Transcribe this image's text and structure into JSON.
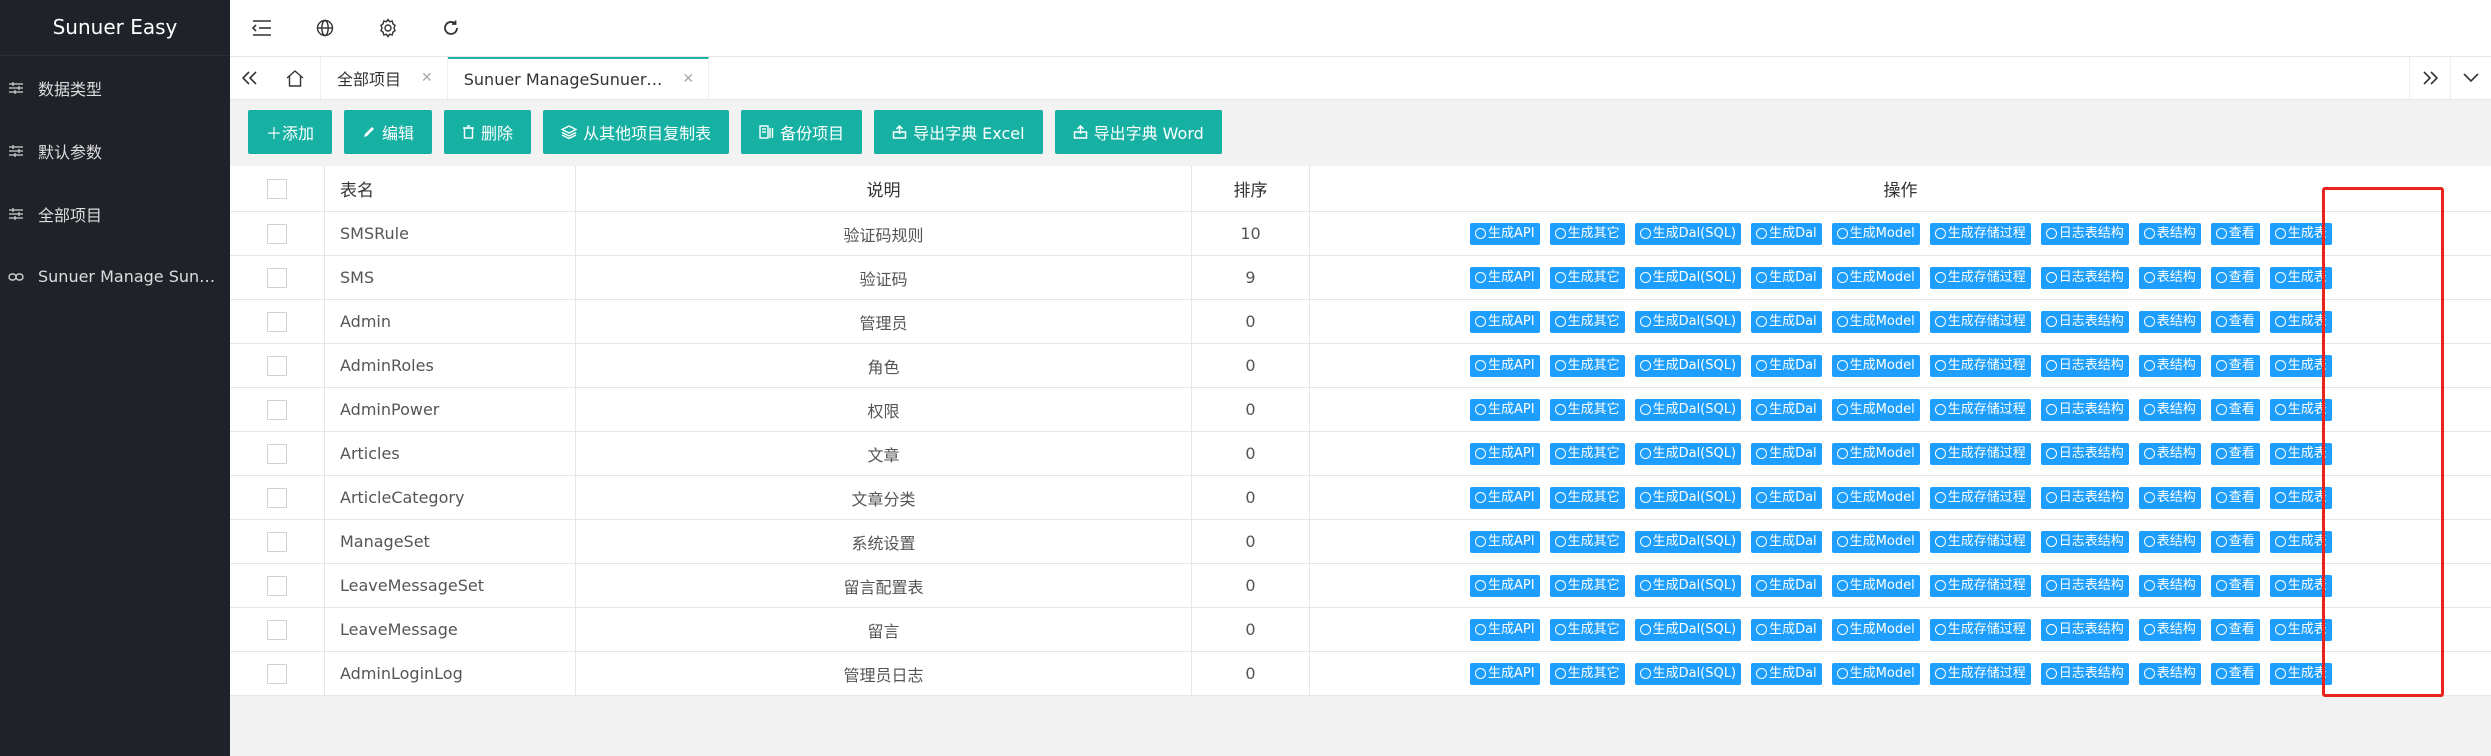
{
  "app": {
    "title": "Sunuer Easy"
  },
  "sidebar": {
    "items": [
      {
        "label": "数据类型",
        "icon": "sliders-icon"
      },
      {
        "label": "默认参数",
        "icon": "sliders-icon"
      },
      {
        "label": "全部项目",
        "icon": "sliders-icon"
      },
      {
        "label": "Sunuer Manage Sun…",
        "icon": "link-icon"
      }
    ]
  },
  "topbar": {
    "icons": [
      "menu-toggle-icon",
      "globe-icon",
      "gear-icon",
      "refresh-icon"
    ]
  },
  "tabs": [
    {
      "label": "全部项目",
      "active": false
    },
    {
      "label": "Sunuer ManageSunuer…",
      "active": true
    }
  ],
  "toolbar": {
    "add": "添加",
    "edit": "编辑",
    "delete": "删除",
    "copy": "从其他项目复制表",
    "backup": "备份项目",
    "export_excel": "导出字典 Excel",
    "export_word": "导出字典 Word"
  },
  "table": {
    "headers": {
      "name": "表名",
      "desc": "说明",
      "sort": "排序",
      "ops": "操作"
    },
    "actions": [
      "生成API",
      "生成其它",
      "生成Dal(SQL)",
      "生成Dal",
      "生成Model",
      "生成存储过程",
      "日志表结构",
      "表结构",
      "查看",
      "生成表"
    ],
    "rows": [
      {
        "name": "SMSRule",
        "desc": "验证码规则",
        "sort": "10"
      },
      {
        "name": "SMS",
        "desc": "验证码",
        "sort": "9"
      },
      {
        "name": "Admin",
        "desc": "管理员",
        "sort": "0"
      },
      {
        "name": "AdminRoles",
        "desc": "角色",
        "sort": "0"
      },
      {
        "name": "AdminPower",
        "desc": "权限",
        "sort": "0"
      },
      {
        "name": "Articles",
        "desc": "文章",
        "sort": "0"
      },
      {
        "name": "ArticleCategory",
        "desc": "文章分类",
        "sort": "0"
      },
      {
        "name": "ManageSet",
        "desc": "系统设置",
        "sort": "0"
      },
      {
        "name": "LeaveMessageSet",
        "desc": "留言配置表",
        "sort": "0"
      },
      {
        "name": "LeaveMessage",
        "desc": "留言",
        "sort": "0"
      },
      {
        "name": "AdminLoginLog",
        "desc": "管理员日志",
        "sort": "0"
      }
    ]
  },
  "colors": {
    "sidebar": "#1f2229",
    "accent": "#16b1a3",
    "action": "#1e9fff",
    "highlight": "#e8241c"
  }
}
